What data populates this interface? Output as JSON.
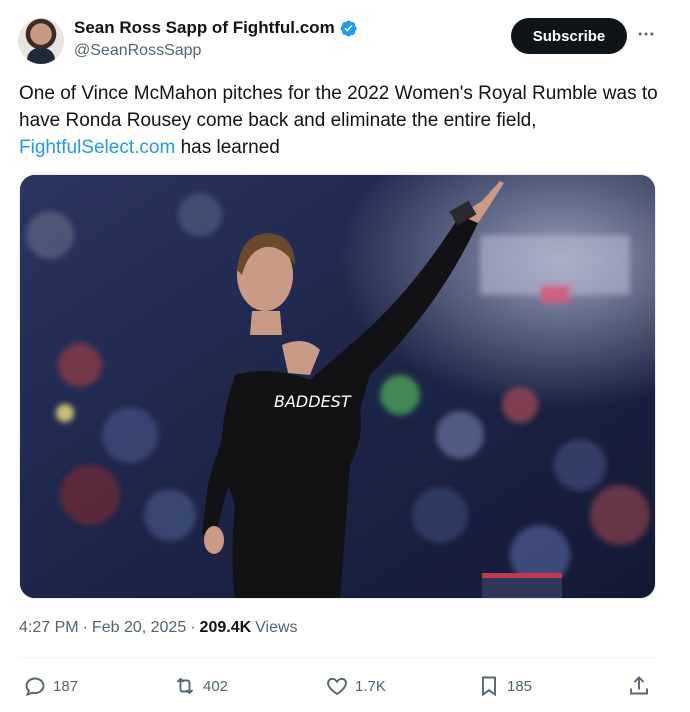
{
  "author": {
    "display_name": "Sean Ross Sapp of Fightful.com",
    "handle": "@SeanRossSapp",
    "verified_icon": "verified-badge-icon",
    "badge_color": "#1d9bf0"
  },
  "header": {
    "subscribe_label": "Subscribe",
    "more_icon": "more-horizontal-icon"
  },
  "tweet": {
    "text_part1": "One of Vince McMahon pitches for the 2022 Women's Royal Rumble was to have Ronda Rousey come back and eliminate the entire field, ",
    "link_text": "FightfulSelect.com",
    "text_part2": " has learned",
    "link_color": "#1d9bf0"
  },
  "media": {
    "shirt_text": "BADDEST"
  },
  "meta": {
    "time": "4:27 PM",
    "separator1": "·",
    "date": "Feb 20, 2025",
    "separator2": "·",
    "views_count": "209.4K",
    "views_label": "Views"
  },
  "actions": {
    "replies": {
      "icon": "reply-icon",
      "count": "187"
    },
    "reposts": {
      "icon": "repost-icon",
      "count": "402"
    },
    "likes": {
      "icon": "like-icon",
      "count": "1.7K"
    },
    "bookmarks": {
      "icon": "bookmark-icon",
      "count": "185"
    },
    "share": {
      "icon": "share-icon"
    }
  }
}
